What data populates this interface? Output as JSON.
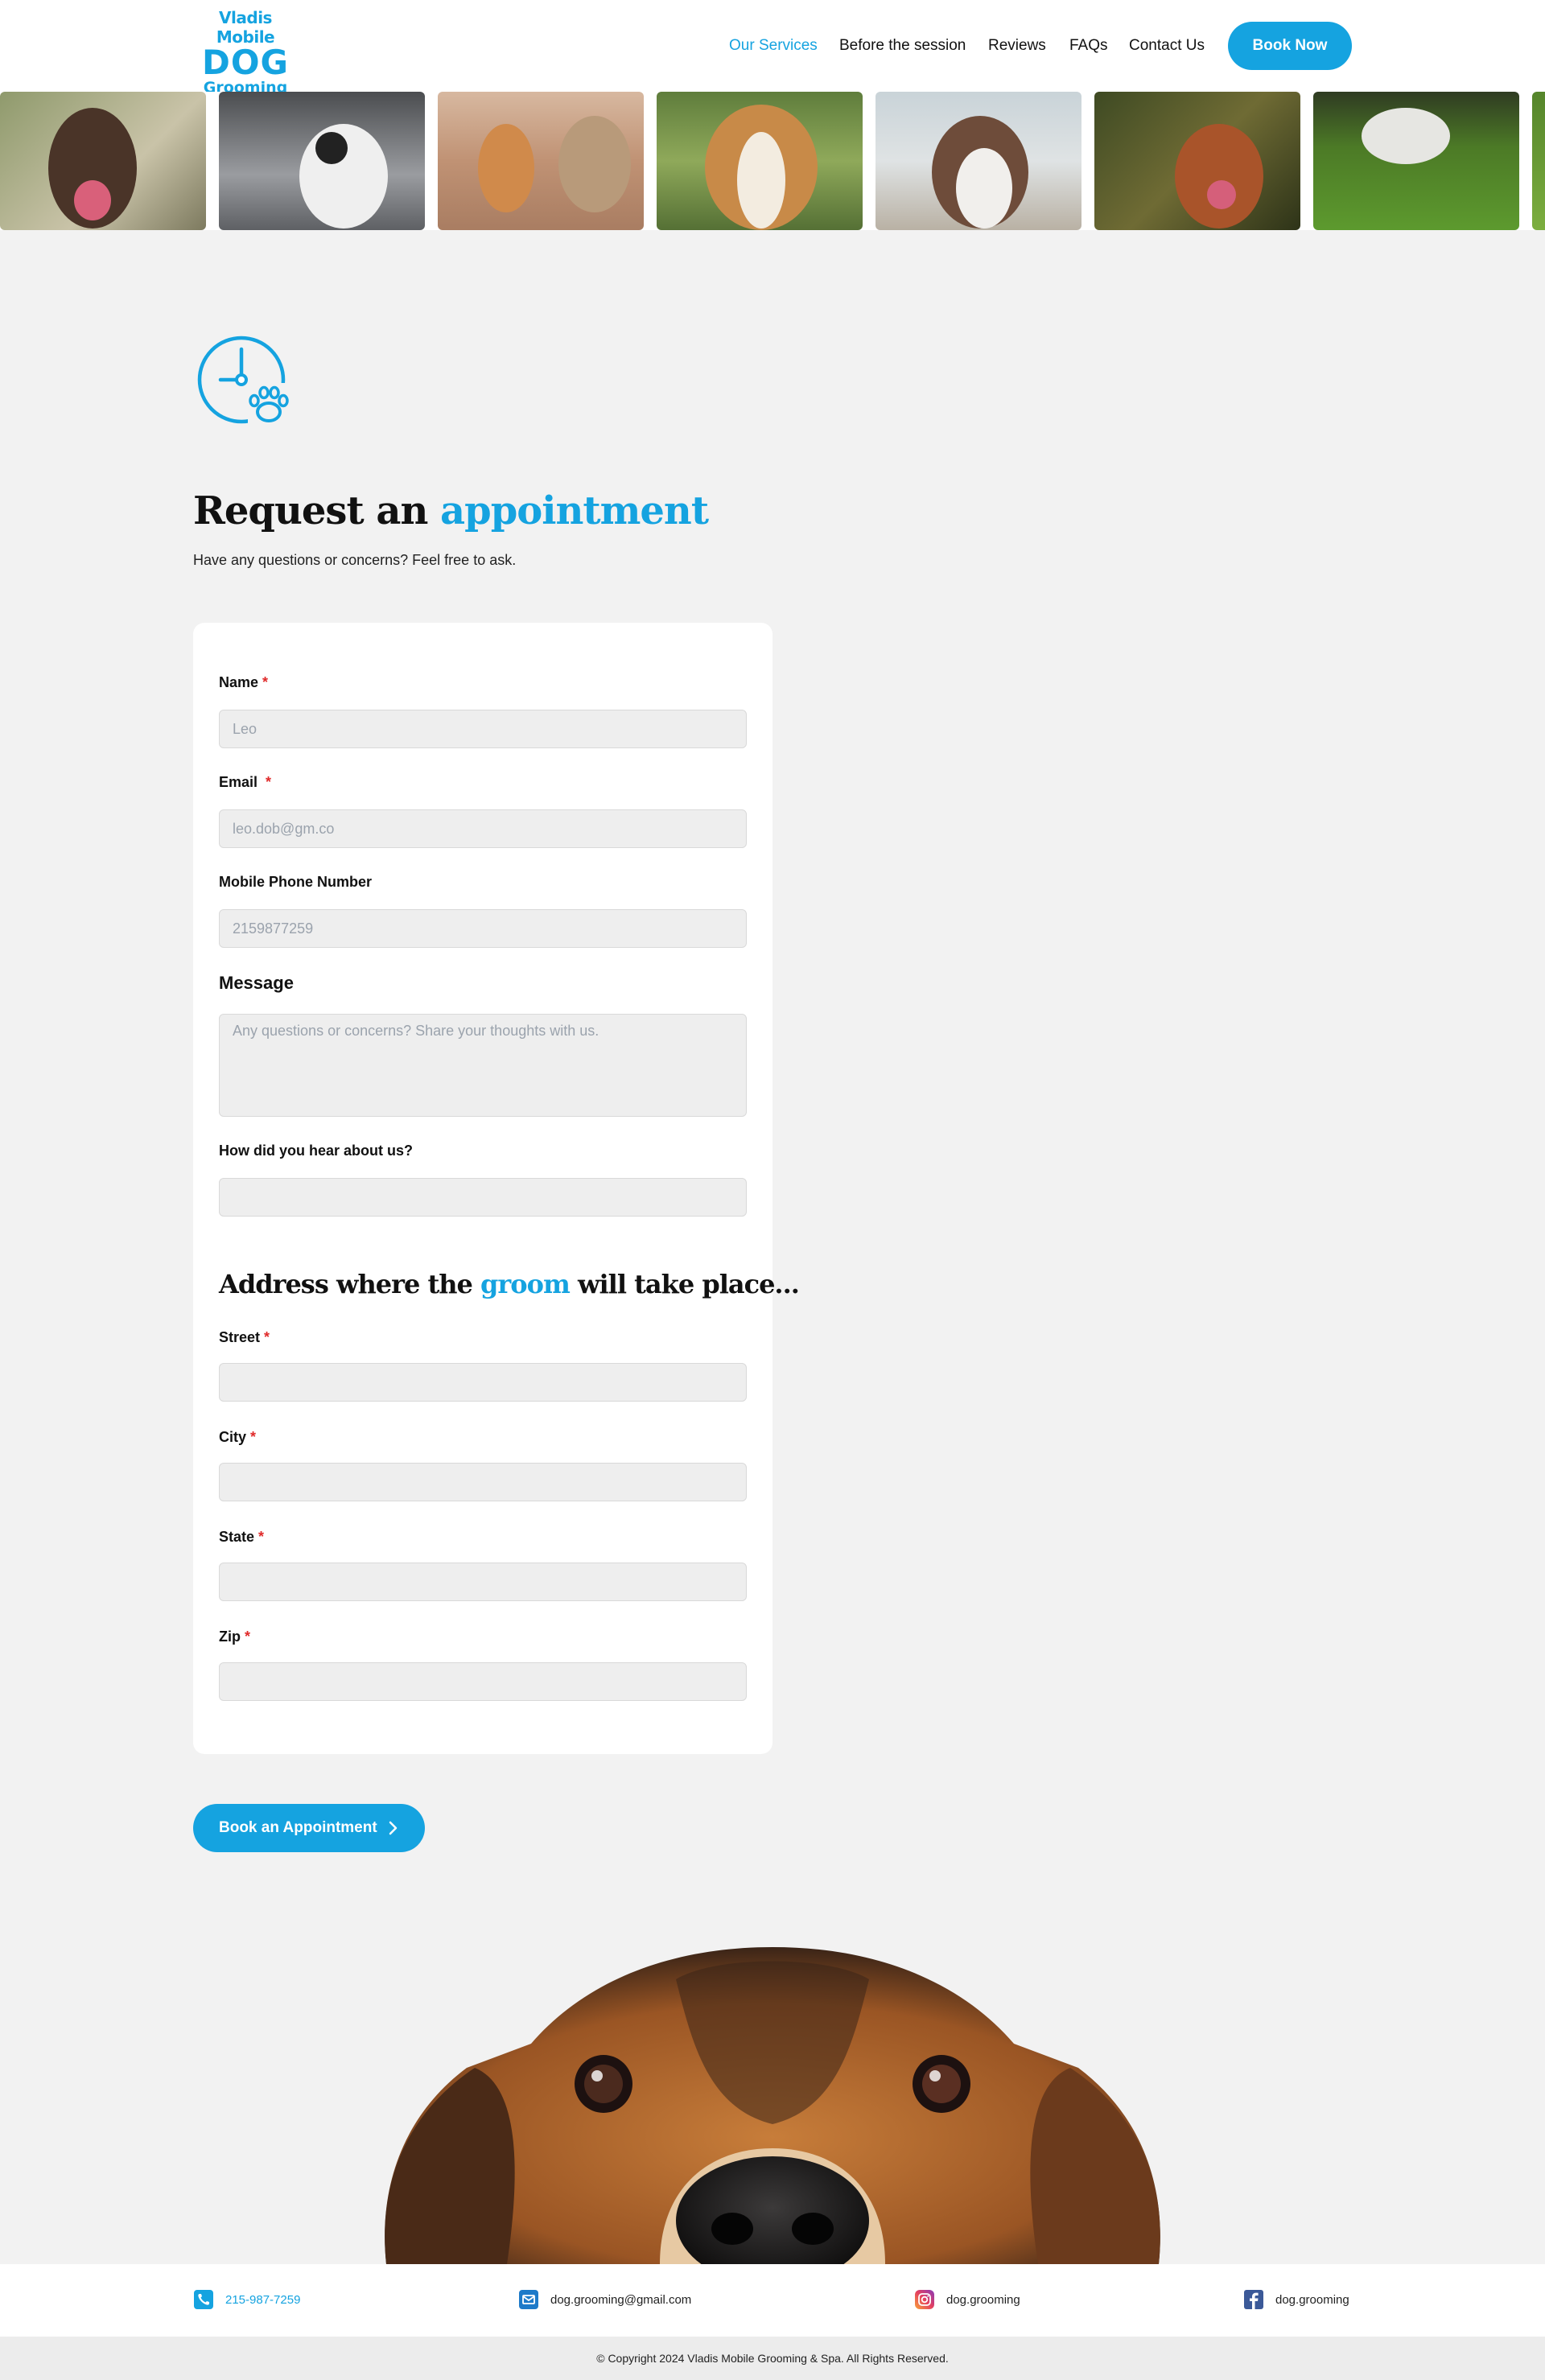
{
  "header": {
    "logo": {
      "line1": "Vladis Mobile",
      "line2": "DOG",
      "line3": "Grooming"
    },
    "nav": [
      {
        "label": "Our Services",
        "active": true
      },
      {
        "label": "Before the session",
        "active": false
      },
      {
        "label": "Reviews",
        "active": false
      },
      {
        "label": "FAQs",
        "active": false
      },
      {
        "label": "Contact Us",
        "active": false
      }
    ],
    "cta_label": "Book Now"
  },
  "gallery": {
    "photo_count": 8
  },
  "hero": {
    "icon": "clock-paw-icon",
    "title_part1": "Request an ",
    "title_highlight": "appointment",
    "subtitle": "Have any questions or concerns? Feel free to ask."
  },
  "form": {
    "name": {
      "label": "Name",
      "required_mark": "*",
      "placeholder": "Leo"
    },
    "email": {
      "label": "Email",
      "required_mark": "*",
      "placeholder": "leo.dob@gm.co"
    },
    "phone": {
      "label": "Mobile Phone Number",
      "placeholder": "2159877259"
    },
    "message": {
      "label": "Message",
      "placeholder": "Any questions or concerns? Share your thoughts with us."
    },
    "referral": {
      "label": "How did you hear about us?",
      "placeholder": ""
    },
    "address_heading": {
      "part1": "Address where the ",
      "highlight": "groom",
      "part2": " will take place..."
    },
    "street": {
      "label": "Street",
      "required_mark": "*"
    },
    "city": {
      "label": "City",
      "required_mark": "*"
    },
    "state": {
      "label": "State",
      "required_mark": "*"
    },
    "zip": {
      "label": "Zip",
      "required_mark": "*"
    },
    "submit_label": "Book an Appointment"
  },
  "footer": {
    "phone": {
      "icon": "phone-icon",
      "text": "215-987-7259"
    },
    "email": {
      "icon": "mail-icon",
      "text": "dog.grooming@gmail.com"
    },
    "instagram": {
      "icon": "instagram-icon",
      "text": "dog.grooming"
    },
    "facebook": {
      "icon": "facebook-icon",
      "text": "dog.grooming"
    },
    "copyright": "© Copyright 2024 Vladis Mobile Grooming & Spa. All Rights Reserved."
  },
  "colors": {
    "accent": "#15a3e0",
    "required": "#e02a2a",
    "page_bg": "#f2f2f2"
  }
}
